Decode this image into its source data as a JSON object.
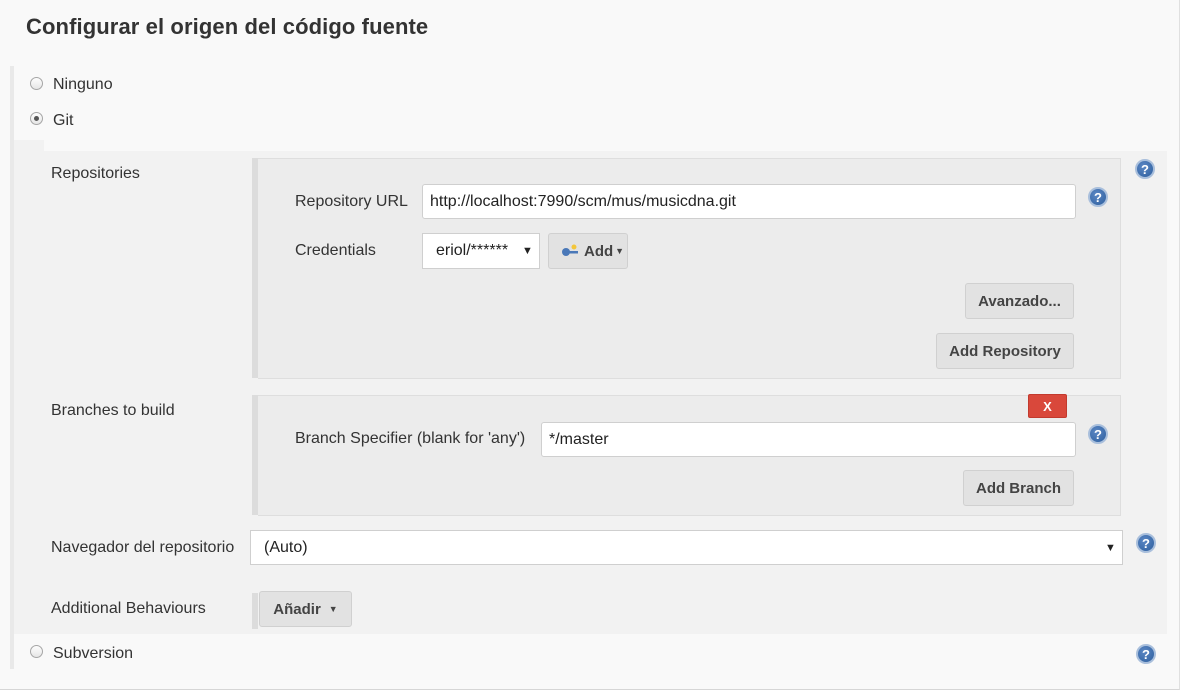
{
  "section_title": "Configurar el origen del código fuente",
  "scm_options": {
    "none": "Ninguno",
    "git": "Git",
    "svn": "Subversion"
  },
  "repositories": {
    "label": "Repositories",
    "url_label": "Repository URL",
    "url_value": "http://localhost:7990/scm/mus/musicdna.git",
    "credentials_label": "Credentials",
    "credentials_value": "eriol/******",
    "add_label": "Add",
    "advanced_label": "Avanzado...",
    "add_repo_label": "Add Repository"
  },
  "branches": {
    "label": "Branches to build",
    "delete_label": "X",
    "specifier_label": "Branch Specifier (blank for 'any')",
    "specifier_value": "*/master",
    "add_branch_label": "Add Branch"
  },
  "browser": {
    "label": "Navegador del repositorio",
    "value": "(Auto)"
  },
  "behaviours": {
    "label": "Additional Behaviours",
    "add_label": "Añadir"
  },
  "help_glyph": "?",
  "icons": {
    "help": "help-icon",
    "key": "key-icon",
    "dropdown": "caret-down-icon"
  },
  "colors": {
    "delete_button": "#d9483b",
    "help_icon": "#2e5f9e"
  }
}
